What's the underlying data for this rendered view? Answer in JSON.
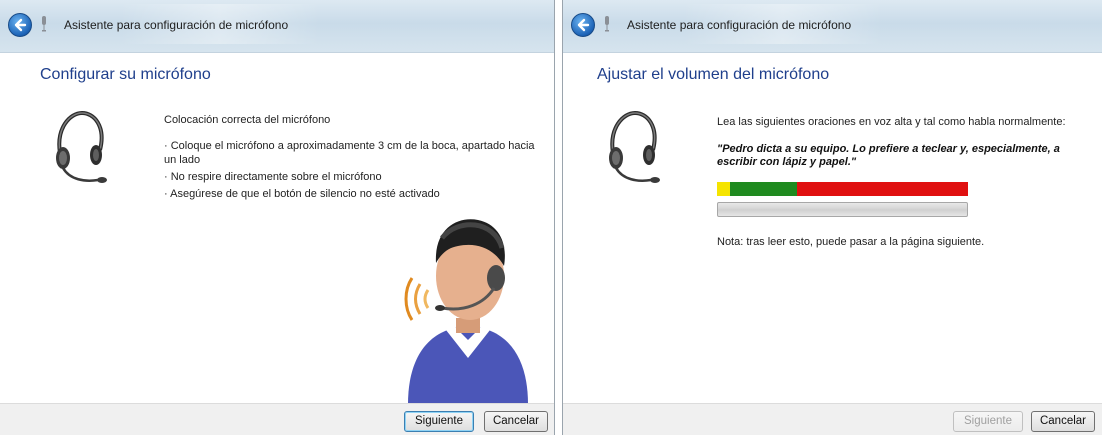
{
  "left_window": {
    "title": "Asistente para configuración de micrófono",
    "heading": "Configurar su micrófono",
    "subheading": "Colocación correcta del micrófono",
    "bullets": [
      "· Coloque el micrófono a aproximadamente 3 cm de la boca, apartado hacia un lado",
      "· No respire directamente sobre el micrófono",
      "· Asegúrese de que el botón de silencio no esté activado"
    ],
    "buttons": {
      "next": "Siguiente",
      "cancel": "Cancelar"
    }
  },
  "right_window": {
    "title": "Asistente para configuración de micrófono",
    "heading": "Ajustar el volumen del micrófono",
    "instruction": "Lea las siguientes oraciones en voz alta y tal como habla normalmente:",
    "quote": "\"Pedro dicta a su equipo. Lo prefiere a teclear y, especialmente, a escribir con lápiz y papel.\"",
    "note": "Nota: tras leer esto, puede pasar a la página siguiente.",
    "volume_meter": {
      "segments": [
        {
          "color": "#f5e400",
          "fraction": 0.05
        },
        {
          "color": "#1f8a1f",
          "fraction": 0.27
        },
        {
          "color": "#e01010",
          "fraction": 0.68
        }
      ]
    },
    "progress_value": 0,
    "buttons": {
      "next": "Siguiente",
      "cancel": "Cancelar",
      "next_disabled": true
    }
  },
  "icons": [
    "back-arrow-icon",
    "microphone-icon",
    "headset-icon",
    "person-with-headset-icon"
  ],
  "colors": {
    "heading": "#1f3f8c",
    "titlebar": "#d0dfeb",
    "footer": "#f0f0f0"
  }
}
